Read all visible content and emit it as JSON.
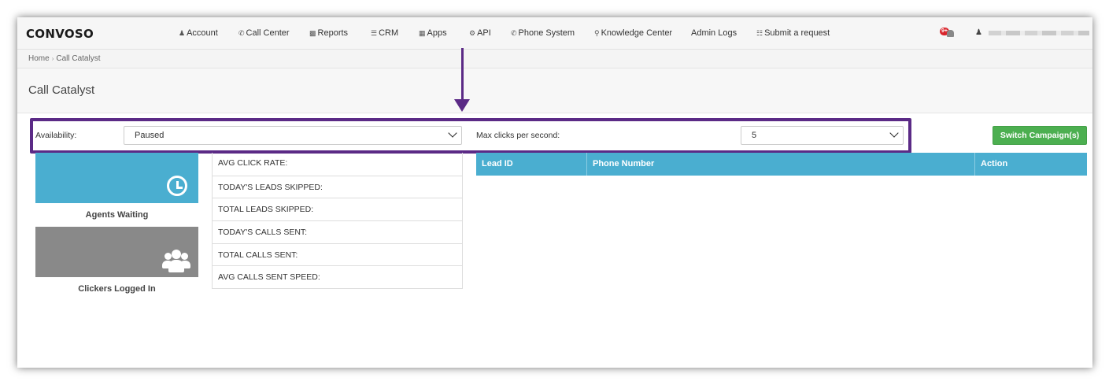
{
  "brand": {
    "logo": "CONVOSO",
    "accent": "#5b2a86",
    "primary_blue": "#4aaed0",
    "green": "#4caf50"
  },
  "nav": {
    "items": [
      {
        "label": "Account",
        "icon": "user-icon"
      },
      {
        "label": "Call Center",
        "icon": "phone-icon"
      },
      {
        "label": "Reports",
        "icon": "bar-chart-icon"
      },
      {
        "label": "CRM",
        "icon": "list-icon"
      },
      {
        "label": "Apps",
        "icon": "grid-icon"
      },
      {
        "label": "API",
        "icon": "gear-icon"
      },
      {
        "label": "Phone System",
        "icon": "phone-icon"
      },
      {
        "label": "Knowledge Center",
        "icon": "lightbulb-icon"
      },
      {
        "label": "Admin Logs",
        "icon": ""
      },
      {
        "label": "Submit a request",
        "icon": "ticket-icon"
      }
    ],
    "notification_badge": "9+"
  },
  "breadcrumb": {
    "home": "Home",
    "current": "Call Catalyst"
  },
  "page_title": "Call Catalyst",
  "controls": {
    "availability_label": "Availability:",
    "availability_value": "Paused",
    "max_clicks_label": "Max clicks per second:",
    "max_clicks_value": "5",
    "switch_button": "Switch Campaign(s)"
  },
  "tiles": [
    {
      "caption": "Agents Waiting",
      "icon": "clock-icon"
    },
    {
      "caption": "Clickers Logged In",
      "icon": "users-icon"
    }
  ],
  "stats": [
    "AVG CLICK RATE:",
    "TODAY'S LEADS SKIPPED:",
    "TOTAL LEADS SKIPPED:",
    "TODAY'S CALLS SENT:",
    "TOTAL CALLS SENT:",
    "AVG CALLS SENT SPEED:"
  ],
  "table": {
    "columns": [
      "Lead ID",
      "Phone Number",
      "Action"
    ]
  }
}
